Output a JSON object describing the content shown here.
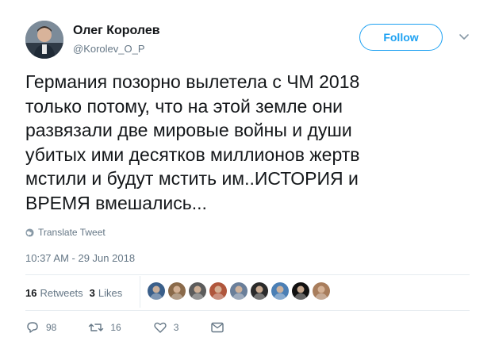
{
  "author": {
    "name": "Олег Королев",
    "handle": "@Korolev_O_P"
  },
  "follow_label": "Follow",
  "tweet_text": "Германия позорно вылетела с ЧМ 2018\nтолько потому, что на этой земле они\nразвязали две мировые войны и души\nубитых ими десятков миллионов жертв\nмстили и будут мстить им..ИСТОРИЯ и\nВРЕМЯ вмешались...",
  "translate_label": "Translate Tweet",
  "timestamp": "10:37 AM - 29 Jun 2018",
  "stats": {
    "retweets_count": "16",
    "retweets_label": "Retweets",
    "likes_count": "3",
    "likes_label": "Likes"
  },
  "liker_avatar_colors": [
    "#3a5f8a",
    "#8a6a4a",
    "#5c5c5c",
    "#b0563c",
    "#6a7f9a",
    "#2b2b2b",
    "#4b7fb5",
    "#111111",
    "#a87d5c"
  ],
  "actions": {
    "replies": "98",
    "retweets": "16",
    "likes": "3"
  },
  "icons": [
    "chevron-down-icon",
    "globe-icon",
    "reply-icon",
    "retweet-icon",
    "heart-icon",
    "message-icon"
  ],
  "colors": {
    "accent": "#1da1f2",
    "secondary_text": "#657786",
    "divider": "#e6ecf0"
  }
}
